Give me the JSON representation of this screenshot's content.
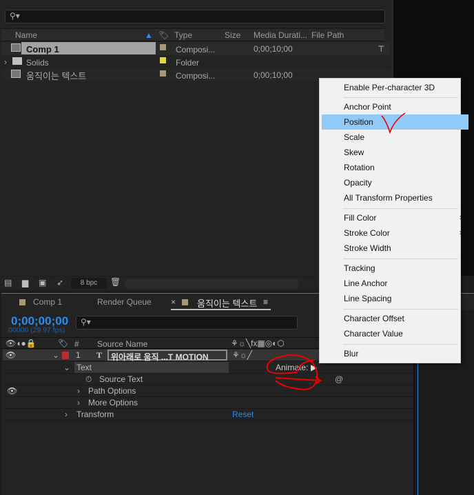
{
  "project": {
    "columns": {
      "name": "Name",
      "type": "Type",
      "size": "Size",
      "duration": "Media Durati...",
      "path": "File Path"
    },
    "items": [
      {
        "name": "Comp 1",
        "type": "Composi...",
        "duration": "0;00;10;00",
        "label": "#a8987a"
      },
      {
        "name": "Solids",
        "type": "Folder",
        "duration": "",
        "label": "#e3d548"
      },
      {
        "name": "움직이는 텍스트",
        "type": "Composi...",
        "duration": "0;00;10;00",
        "label": "#a8987a"
      }
    ],
    "bpc": "8 bpc"
  },
  "timeline": {
    "tabs": [
      {
        "label": "Comp 1"
      },
      {
        "label": "Render Queue"
      },
      {
        "label": "움직이는 텍스트"
      }
    ],
    "timecode": "0;00;00;00",
    "frames": "00000 (29.97 fps)",
    "col_num": "#",
    "col_source": "Source Name",
    "layer": {
      "num": "1",
      "name": "위아래로 움직 ...T MOTION"
    },
    "props": {
      "text": "Text",
      "animate": "Animate:",
      "source_text": "Source Text",
      "path_options": "Path Options",
      "more_options": "More Options",
      "transform": "Transform",
      "reset": "Reset"
    }
  },
  "menu": {
    "items": [
      "Enable Per-character 3D",
      "Anchor Point",
      "Position",
      "Scale",
      "Skew",
      "Rotation",
      "Opacity",
      "All Transform Properties",
      "Fill Color",
      "Stroke Color",
      "Stroke Width",
      "Tracking",
      "Line Anchor",
      "Line Spacing",
      "Character Offset",
      "Character Value",
      "Blur"
    ]
  }
}
